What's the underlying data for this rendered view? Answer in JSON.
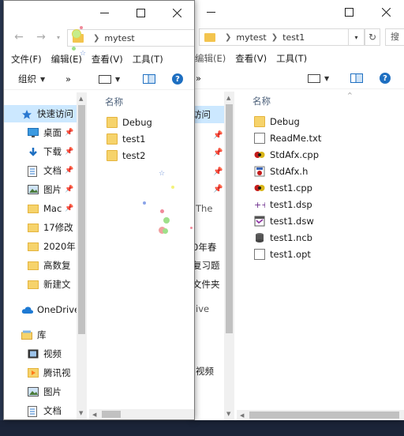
{
  "back_window": {
    "breadcrumb": [
      "mytest",
      "test1"
    ],
    "search_placeholder": "搜",
    "menu": [
      "查看(V)",
      "工具(T)"
    ],
    "menu_partial": "编辑(E)",
    "toolbar_expand": "»",
    "column_name": "名称",
    "files": [
      {
        "name": "Debug",
        "icon": "folder-icon"
      },
      {
        "name": "ReadMe.txt",
        "icon": "text-file-icon"
      },
      {
        "name": "StdAfx.cpp",
        "icon": "cpp-file-icon"
      },
      {
        "name": "StdAfx.h",
        "icon": "header-file-icon"
      },
      {
        "name": "test1.cpp",
        "icon": "cpp-file-icon"
      },
      {
        "name": "test1.dsp",
        "icon": "dsp-file-icon"
      },
      {
        "name": "test1.dsw",
        "icon": "vs-workspace-icon"
      },
      {
        "name": "test1.ncb",
        "icon": "database-file-icon"
      },
      {
        "name": "test1.opt",
        "icon": "blank-file-icon"
      }
    ],
    "nav_fragments": [
      "访问",
      "The",
      "0年春",
      "复习题",
      "文件夹",
      "ive",
      "视频"
    ]
  },
  "front_window": {
    "breadcrumb": [
      "mytest"
    ],
    "menu": [
      "文件(F)",
      "编辑(E)",
      "查看(V)",
      "工具(T)"
    ],
    "toolbar": {
      "organize": "组织",
      "expand": "»"
    },
    "column_name": "名称",
    "nav": [
      {
        "label": "快速访问",
        "icon": "star-icon",
        "selected": true,
        "pinned": false
      },
      {
        "label": "桌面",
        "icon": "desktop-icon",
        "pinned": true
      },
      {
        "label": "下载",
        "icon": "download-icon",
        "pinned": true
      },
      {
        "label": "文档",
        "icon": "documents-icon",
        "pinned": true
      },
      {
        "label": "图片",
        "icon": "pictures-icon",
        "pinned": true
      },
      {
        "label": "Mac",
        "icon": "folder-icon",
        "pinned": true
      },
      {
        "label": "17修改",
        "icon": "folder-icon",
        "pinned": false
      },
      {
        "label": "2020年",
        "icon": "folder-icon",
        "pinned": false
      },
      {
        "label": "高数复",
        "icon": "folder-icon",
        "pinned": false
      },
      {
        "label": "新建文",
        "icon": "folder-icon",
        "pinned": false
      },
      {
        "label": "OneDrive",
        "icon": "cloud-icon",
        "pinned": false
      },
      {
        "label": "库",
        "icon": "library-icon",
        "pinned": false
      },
      {
        "label": "视频",
        "icon": "videos-icon",
        "pinned": false
      },
      {
        "label": "腾讯视",
        "icon": "tencent-video-icon",
        "pinned": false
      },
      {
        "label": "图片",
        "icon": "pictures-icon",
        "pinned": false
      },
      {
        "label": "文档",
        "icon": "documents-icon",
        "pinned": false
      }
    ],
    "files": [
      {
        "name": "Debug",
        "icon": "folder-icon"
      },
      {
        "name": "test1",
        "icon": "folder-icon"
      },
      {
        "name": "test2",
        "icon": "folder-icon"
      }
    ]
  },
  "colors": {
    "folder": "#f6d36b",
    "selection": "#cce8ff",
    "accent": "#1e6fc1"
  }
}
